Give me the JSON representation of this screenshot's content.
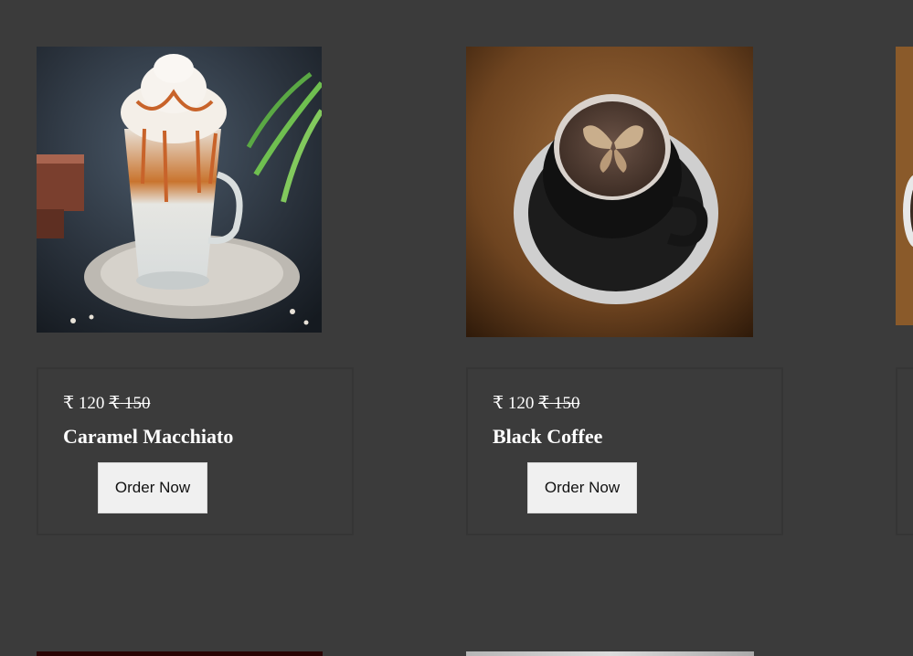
{
  "products": [
    {
      "name": "Caramel Macchiato",
      "currency": "₹",
      "price": "120",
      "original_price": "150",
      "button_label": "Order Now"
    },
    {
      "name": "Black Coffee",
      "currency": "₹",
      "price": "120",
      "original_price": "150",
      "button_label": "Order Now"
    }
  ]
}
